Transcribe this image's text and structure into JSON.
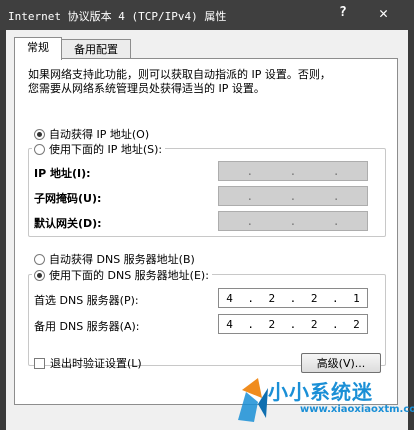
{
  "window": {
    "title": "Internet 协议版本 4 (TCP/IPv4) 属性",
    "help_glyph": "?",
    "close_glyph": "✕"
  },
  "tabs": [
    {
      "label": "常规",
      "active": true
    },
    {
      "label": "备用配置",
      "active": false
    }
  ],
  "description": [
    "如果网络支持此功能，则可以获取自动指派的 IP 设置。否则，",
    "您需要从网络系统管理员处获得适当的 IP 设置。"
  ],
  "ip_section": {
    "auto_option": {
      "label": "自动获得 IP 地址(O)",
      "selected": true
    },
    "manual_option": {
      "label": "使用下面的 IP 地址(S):",
      "selected": false
    },
    "fields": [
      {
        "label": "IP 地址(I):",
        "octets": [
          "",
          "",
          "",
          ""
        ]
      },
      {
        "label": "子网掩码(U):",
        "octets": [
          "",
          "",
          "",
          ""
        ]
      },
      {
        "label": "默认网关(D):",
        "octets": [
          "",
          "",
          "",
          ""
        ]
      }
    ]
  },
  "dns_section": {
    "auto_option": {
      "label": "自动获得 DNS 服务器地址(B)",
      "selected": false
    },
    "manual_option": {
      "label": "使用下面的 DNS 服务器地址(E):",
      "selected": true
    },
    "fields": [
      {
        "label": "首选 DNS 服务器(P):",
        "octets": [
          "4",
          "2",
          "2",
          "1"
        ]
      },
      {
        "label": "备用 DNS 服务器(A):",
        "octets": [
          "4",
          "2",
          "2",
          "2"
        ]
      }
    ]
  },
  "footer": {
    "validate_checkbox": {
      "label": "退出时验证设置(L)",
      "checked": false
    },
    "advanced_button": "高级(V)..."
  },
  "watermark": {
    "text": "小小系统迷",
    "url": "www.xiaoxiaoxtm.com"
  },
  "colors": {
    "titlebar": "#3f3f3f",
    "client": "#f0f0f0",
    "disabled_field": "#cfcfcf",
    "watermark_blue": "#1a8fd6"
  }
}
